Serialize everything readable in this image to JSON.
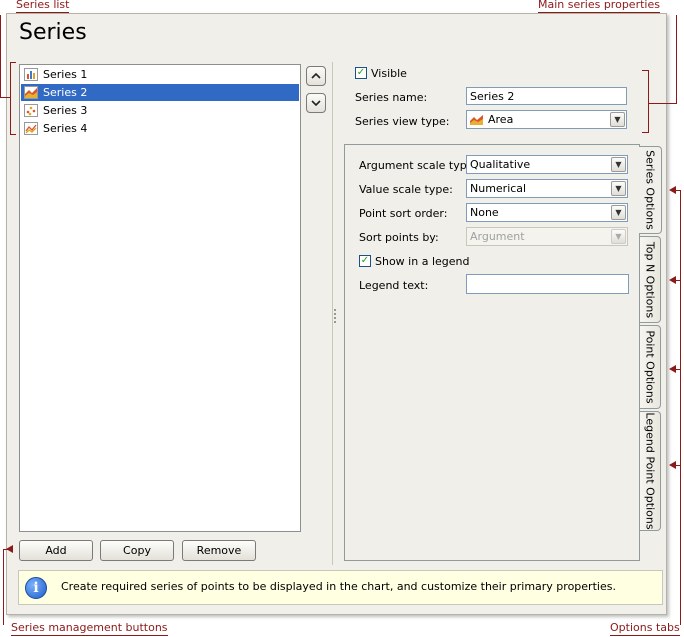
{
  "annotations": {
    "series_list": "Series list",
    "main_series_properties": "Main series properties",
    "series_management_buttons": "Series management buttons",
    "options_tabs": "Options tabs"
  },
  "dialog": {
    "title": "Series"
  },
  "series_list": {
    "items": [
      {
        "label": "Series 1",
        "icon": "bar-chart-icon",
        "selected": false
      },
      {
        "label": "Series 2",
        "icon": "area-chart-icon",
        "selected": true
      },
      {
        "label": "Series 3",
        "icon": "point-chart-icon",
        "selected": false
      },
      {
        "label": "Series 4",
        "icon": "line-chart-icon",
        "selected": false
      }
    ]
  },
  "buttons": {
    "add": "Add",
    "copy": "Copy",
    "remove": "Remove"
  },
  "main_properties": {
    "visible_label": "Visible",
    "visible_checked": true,
    "series_name_label": "Series name:",
    "series_name_value": "Series 2",
    "view_type_label": "Series view type:",
    "view_type_value": "Area"
  },
  "series_options": {
    "argument_scale_type_label": "Argument scale type:",
    "argument_scale_type_value": "Qualitative",
    "value_scale_type_label": "Value scale type:",
    "value_scale_type_value": "Numerical",
    "point_sort_order_label": "Point sort order:",
    "point_sort_order_value": "None",
    "sort_points_by_label": "Sort points by:",
    "sort_points_by_value": "Argument",
    "show_in_legend_label": "Show in a legend",
    "show_in_legend_checked": true,
    "legend_text_label": "Legend text:",
    "legend_text_value": ""
  },
  "tabs": [
    {
      "label": "Series Options",
      "active": true
    },
    {
      "label": "Top N Options",
      "active": false
    },
    {
      "label": "Point Options",
      "active": false
    },
    {
      "label": "Legend Point Options",
      "active": false
    }
  ],
  "info": {
    "text": "Create required series of points to be displayed in the chart, and customize their primary properties."
  },
  "colors": {
    "annotation": "#8b1a1a",
    "selection": "#316ac5",
    "info_background": "#ffffe1"
  }
}
